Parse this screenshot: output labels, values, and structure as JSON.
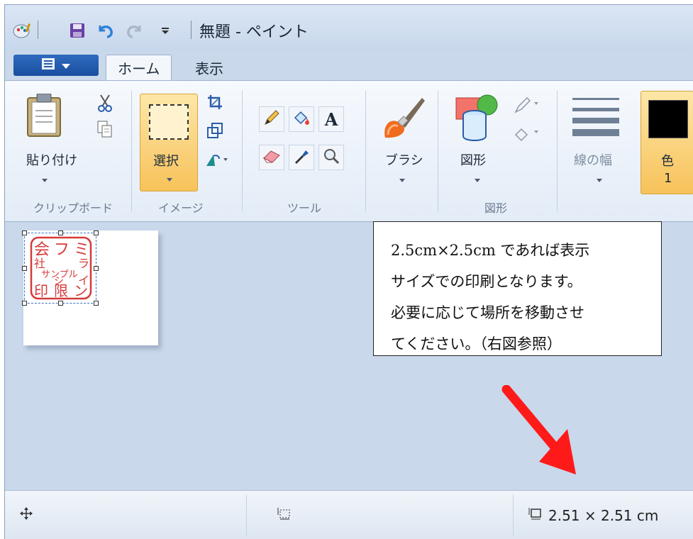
{
  "window": {
    "title": "無題 - ペイント"
  },
  "tabs": [
    {
      "label": "ホーム",
      "active": true
    },
    {
      "label": "表示",
      "active": false
    }
  ],
  "ribbon": {
    "clipboard": {
      "paste_label": "貼り付け",
      "group_label": "クリップボード"
    },
    "image": {
      "select_label": "選択",
      "group_label": "イメージ"
    },
    "tools": {
      "group_label": "ツール",
      "text_tool": "A"
    },
    "brush": {
      "label": "ブラシ"
    },
    "shapes": {
      "label": "図形",
      "group_label": "図形"
    },
    "size": {
      "label": "線の幅"
    },
    "color": {
      "label": "色",
      "index": "1",
      "swatch": "#000000"
    }
  },
  "stamp": {
    "col1": "会",
    "col1b": "社",
    "col1c": "印",
    "col2": "フ",
    "col2b": "シ",
    "col2c": "限",
    "col3": "ミ",
    "col3b": "ラ",
    "col3c": "イ",
    "col3d": "ン",
    "sample": "サンプル",
    "color": "#d63a3a"
  },
  "callout": {
    "lines": [
      "2.5cm×2.5cm であれば表示",
      "サイズでの印刷となります。",
      "必要に応じて場所を移動させ",
      "てください。（右図参照）"
    ]
  },
  "statusbar": {
    "image_size": "2.51 × 2.51 cm"
  },
  "colors": {
    "accent": "#f7c25a",
    "arrow": "#ff1a1a"
  }
}
